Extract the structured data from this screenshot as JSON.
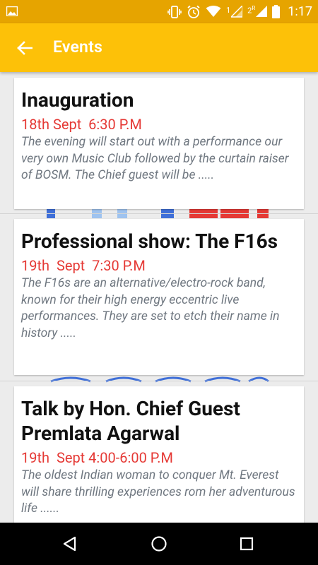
{
  "status_bar": {
    "sim1": "1",
    "sim2": "2",
    "sim2_roaming": "R",
    "time": "1:17",
    "icons": [
      "image-icon",
      "vibrate-icon",
      "alarm-icon",
      "wifi-icon",
      "signal-icon",
      "battery-icon"
    ]
  },
  "app_bar": {
    "title": "Events",
    "background": "#fdc108"
  },
  "events": [
    {
      "title": "Inauguration",
      "date": "18th Sept  6:30 P.M",
      "description": "The evening will start out with a performance our very own Music Club followed by the curtain raiser of BOSM. The Chief guest will be  ....."
    },
    {
      "title": "Professional show: The F16s",
      "date": "19th  Sept  7:30 P.M",
      "description": "The F16s are an alternative/electro-rock band, known for their high energy eccentric live performances. They are set to etch their name in history ....."
    },
    {
      "title": "Talk by Hon. Chief Guest Premlata Agarwal",
      "date": "19th  Sept 4:00-6:00 P.M",
      "description": "The oldest Indian woman to conquer Mt. Everest will share thrilling experiences rom her adventurous life ......"
    }
  ],
  "colors": {
    "date_red": "#e53935",
    "status_bar": "#e6a400"
  },
  "nav_bar": {
    "icons": [
      "back-triangle-icon",
      "home-circle-icon",
      "recents-square-icon"
    ]
  }
}
